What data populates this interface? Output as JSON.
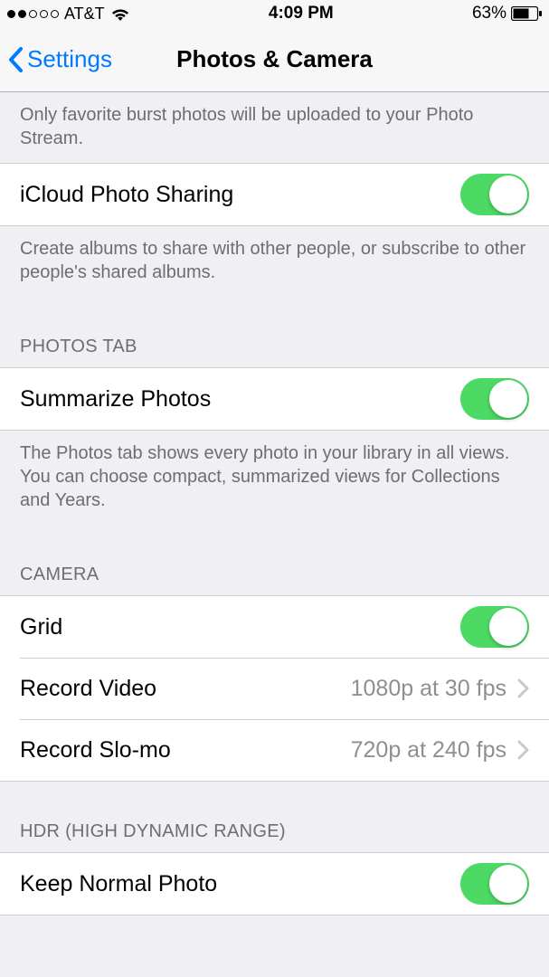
{
  "status": {
    "carrier": "AT&T",
    "time": "4:09 PM",
    "battery_pct": "63%"
  },
  "nav": {
    "back_label": "Settings",
    "title": "Photos & Camera"
  },
  "sections": {
    "burst_footer": "Only favorite burst photos will be uploaded to your Photo Stream.",
    "icloud_sharing": {
      "label": "iCloud Photo Sharing",
      "footer": "Create albums to share with other people, or subscribe to other people's shared albums."
    },
    "photos_tab": {
      "header": "PHOTOS TAB",
      "summarize_label": "Summarize Photos",
      "footer": "The Photos tab shows every photo in your library in all views. You can choose compact, summarized views for Collections and Years."
    },
    "camera": {
      "header": "CAMERA",
      "grid_label": "Grid",
      "record_video_label": "Record Video",
      "record_video_value": "1080p at 30 fps",
      "record_slomo_label": "Record Slo-mo",
      "record_slomo_value": "720p at 240 fps"
    },
    "hdr": {
      "header": "HDR (HIGH DYNAMIC RANGE)",
      "keep_normal_label": "Keep Normal Photo"
    }
  }
}
